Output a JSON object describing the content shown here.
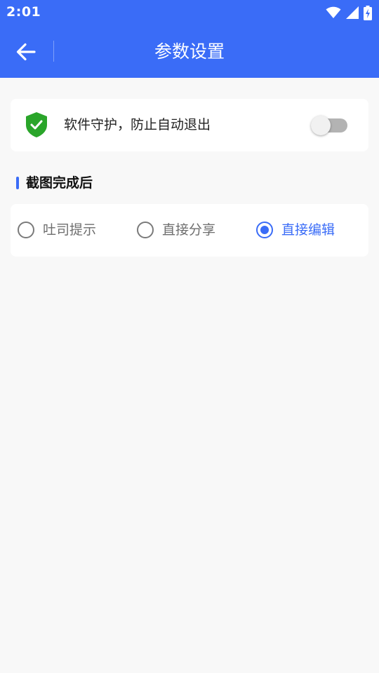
{
  "status_bar": {
    "time": "2:01",
    "icons": [
      "wifi-icon",
      "cell-signal-icon",
      "battery-charging-icon"
    ]
  },
  "app_bar": {
    "title": "参数设置",
    "back_icon": "arrow-left-icon"
  },
  "guard_setting": {
    "icon": "shield-check-icon",
    "label": "软件守护，防止自动退出",
    "enabled": false
  },
  "screenshot_section": {
    "title": "截图完成后",
    "options": [
      {
        "label": "吐司提示",
        "selected": false
      },
      {
        "label": "直接分享",
        "selected": false
      },
      {
        "label": "直接编辑",
        "selected": true
      }
    ]
  },
  "colors": {
    "primary": "#3a6cf7",
    "shield": "#2aa52a",
    "background": "#f8f8f8"
  }
}
